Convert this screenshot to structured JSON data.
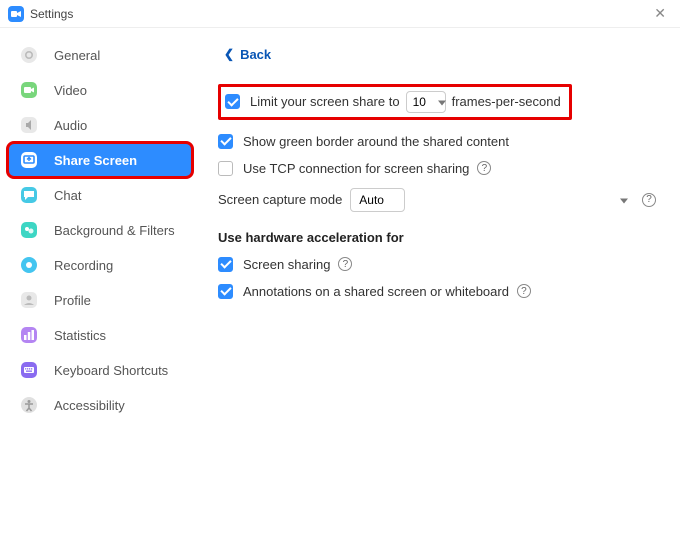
{
  "window": {
    "title": "Settings"
  },
  "sidebar": {
    "items": [
      {
        "label": "General"
      },
      {
        "label": "Video"
      },
      {
        "label": "Audio"
      },
      {
        "label": "Share Screen"
      },
      {
        "label": "Chat"
      },
      {
        "label": "Background & Filters"
      },
      {
        "label": "Recording"
      },
      {
        "label": "Profile"
      },
      {
        "label": "Statistics"
      },
      {
        "label": "Keyboard Shortcuts"
      },
      {
        "label": "Accessibility"
      }
    ]
  },
  "main": {
    "back": "Back",
    "limit_prefix": "Limit your screen share to",
    "limit_suffix": "frames-per-second",
    "limit_value": "10",
    "green_border": "Show green border around the shared content",
    "tcp": "Use TCP connection for screen sharing",
    "capture_mode_label": "Screen capture mode",
    "capture_mode_value": "Auto",
    "hw_title": "Use hardware acceleration for",
    "hw_screen": "Screen sharing",
    "hw_annot": "Annotations on a shared screen or whiteboard"
  }
}
